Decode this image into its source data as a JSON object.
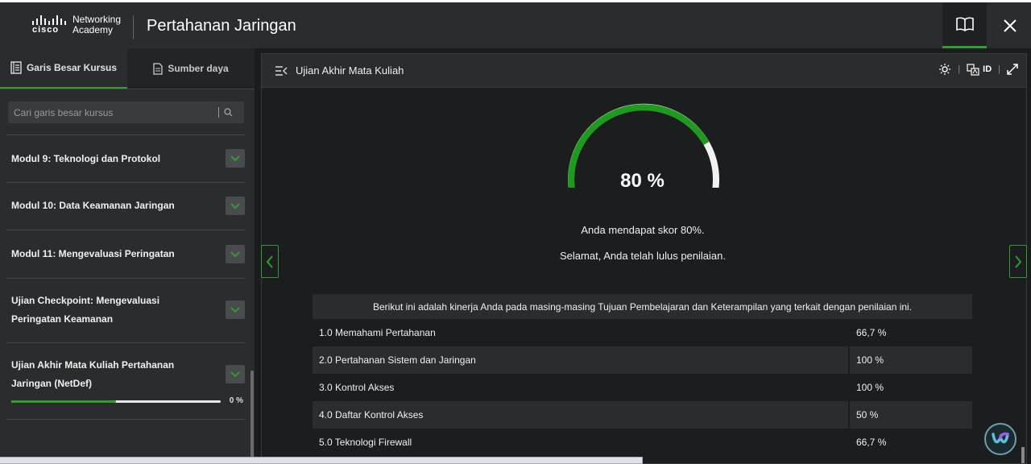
{
  "header": {
    "logo_brand": "cisco",
    "logo_line1": "Networking",
    "logo_line2": "Academy",
    "title": "Pertahanan Jaringan"
  },
  "sidebar": {
    "tabs": [
      {
        "label": "Garis Besar Kursus",
        "icon": "outline-icon",
        "active": true
      },
      {
        "label": "Sumber daya",
        "icon": "document-icon",
        "active": false
      }
    ],
    "search_placeholder": "Cari garis besar kursus",
    "items": [
      {
        "label": "Modul 9: Teknologi dan Protokol"
      },
      {
        "label": "Modul 10: Data Keamanan Jaringan"
      },
      {
        "label": "Modul 11: Mengevaluasi Peringatan"
      },
      {
        "label": "Ujian Checkpoint: Mengevaluasi Peringatan Keamanan"
      },
      {
        "label": "Ujian Akhir Mata Kuliah Pertahanan Jaringan (NetDef)",
        "progress_label": "0 %",
        "progress": 0.5
      }
    ]
  },
  "main": {
    "title": "Ujian Akhir Mata Kuliah",
    "lang": "ID",
    "score": 0.8,
    "score_label": "80 %",
    "message1": "Anda mendapat skor 80%.",
    "message2": "Selamat, Anda telah lulus penilaian.",
    "table_header": "Berikut ini adalah kinerja Anda pada masing-masing Tujuan Pembelajaran dan Keterampilan yang terkait dengan penilaian ini.",
    "rows": [
      {
        "objective": "1.0 Memahami Pertahanan",
        "score": "66,7 %"
      },
      {
        "objective": "2.0 Pertahanan Sistem dan Jaringan",
        "score": "100 %"
      },
      {
        "objective": "3.0 Kontrol Akses",
        "score": "100 %"
      },
      {
        "objective": "4.0 Daftar Kontrol Akses",
        "score": "50 %"
      },
      {
        "objective": "5.0 Teknologi Firewall",
        "score": "66,7 %"
      }
    ]
  },
  "colors": {
    "accent": "#2e9e2e",
    "panel": "#2b2c2e",
    "background": "#1c1d1f"
  }
}
